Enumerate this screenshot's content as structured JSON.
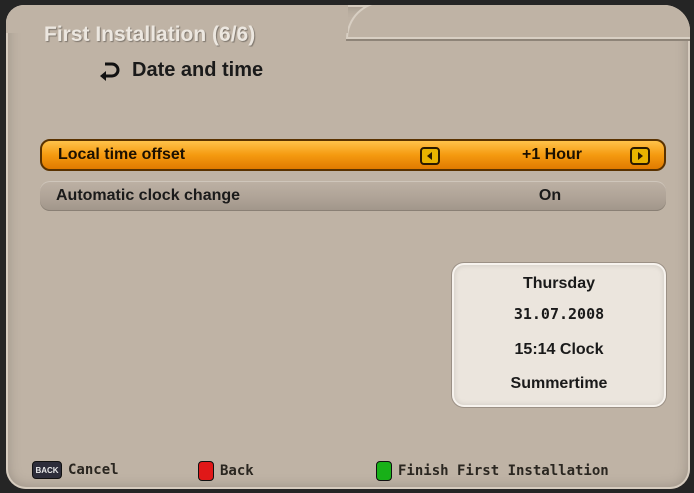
{
  "header": {
    "title": "First Installation (6/6)",
    "subtitle": "Date and time",
    "subtitle_icon": "return-arrow-icon"
  },
  "settings": [
    {
      "label": "Local time offset",
      "value": "+1 Hour",
      "selected": true
    },
    {
      "label": "Automatic clock change",
      "value": "On",
      "selected": false
    }
  ],
  "info": {
    "day": "Thursday",
    "date": "31.07.2008",
    "time": "15:14 Clock",
    "mode": "Summertime"
  },
  "footer": {
    "back_key_label": "BACK",
    "cancel_label": "Cancel",
    "back_label": "Back",
    "finish_label": "Finish First Installation"
  },
  "colors": {
    "panel": "#bfb3a5",
    "highlight": "#f59a10",
    "red_key": "#e01818",
    "green_key": "#18b018",
    "info_box": "#ebe5dd"
  }
}
